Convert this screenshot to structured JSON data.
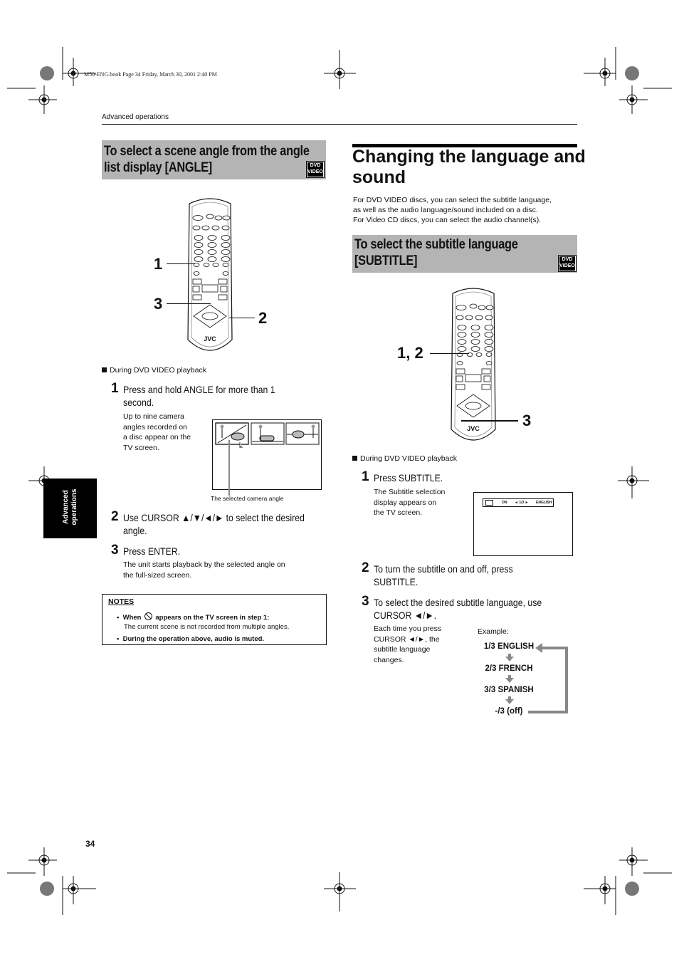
{
  "book_info": "M50-ENG.book  Page 34  Friday, March 30, 2001  2:40 PM",
  "running_header": "Advanced operations",
  "side_tab": "Advanced operations",
  "page_number": "34",
  "badge": {
    "line1": "DVD",
    "line2": "VIDEO"
  },
  "left": {
    "heading_line1": "To select a scene angle from the angle",
    "heading_line2": "list display [ANGLE]",
    "callouts": {
      "c1": "1",
      "c2": "2",
      "c3": "3"
    },
    "remote_brand": "JVC",
    "during": "During DVD VIDEO playback",
    "steps": [
      {
        "num": "1",
        "text_line1": "Press and hold ANGLE for more than 1",
        "text_line2": "second.",
        "desc": [
          "Up to nine camera",
          "angles recorded on",
          "a disc appear on the",
          "TV screen."
        ]
      },
      {
        "num": "2",
        "text_line1": "Use CURSOR ▲/▼/◄/► to select the desired",
        "text_line2": "angle."
      },
      {
        "num": "3",
        "text_line1": "Press ENTER.",
        "desc": [
          "The unit starts playback by the selected angle on",
          "the full-sized screen."
        ]
      }
    ],
    "angle_caption": "The selected camera angle",
    "notes": {
      "title": "NOTES",
      "items": [
        {
          "bold_pre": "When",
          "icon": "prohibited-icon",
          "bold_post": "appears on the TV screen in step 1:",
          "normal": "The current scene is not recorded from multiple angles."
        },
        {
          "bold": "During the operation above, audio is muted."
        }
      ]
    }
  },
  "right": {
    "title_line1": "Changing the language and",
    "title_line2": "sound",
    "intro": [
      "For DVD VIDEO discs, you can select the subtitle language,",
      "as well as the audio language/sound included on a disc.",
      "For Video CD discs, you can select the audio channel(s)."
    ],
    "heading_line1": "To select the subtitle language",
    "heading_line2": "[SUBTITLE]",
    "callouts": {
      "c12": "1, 2",
      "c3": "3"
    },
    "remote_brand": "JVC",
    "during": "During DVD VIDEO playback",
    "steps": [
      {
        "num": "1",
        "text_line1": "Press SUBTITLE.",
        "desc": [
          "The Subtitle selection",
          "display appears on",
          "the TV screen."
        ]
      },
      {
        "num": "2",
        "text_line1": "To turn the subtitle on and off, press",
        "text_line2": "SUBTITLE."
      },
      {
        "num": "3",
        "text_line1": "To select the desired subtitle language, use",
        "text_line2": "CURSOR ◄/►.",
        "desc": [
          "Each time you press",
          "CURSOR ◄/►, the",
          "subtitle language",
          "changes."
        ]
      }
    ],
    "osd": {
      "state": "ON",
      "track": "◄ 1/3 ►",
      "language": "ENGLISH"
    },
    "example_label": "Example:",
    "cycle": [
      "1/3 ENGLISH",
      "2/3 FRENCH",
      "3/3 SPANISH",
      "-/3 (off)"
    ]
  }
}
